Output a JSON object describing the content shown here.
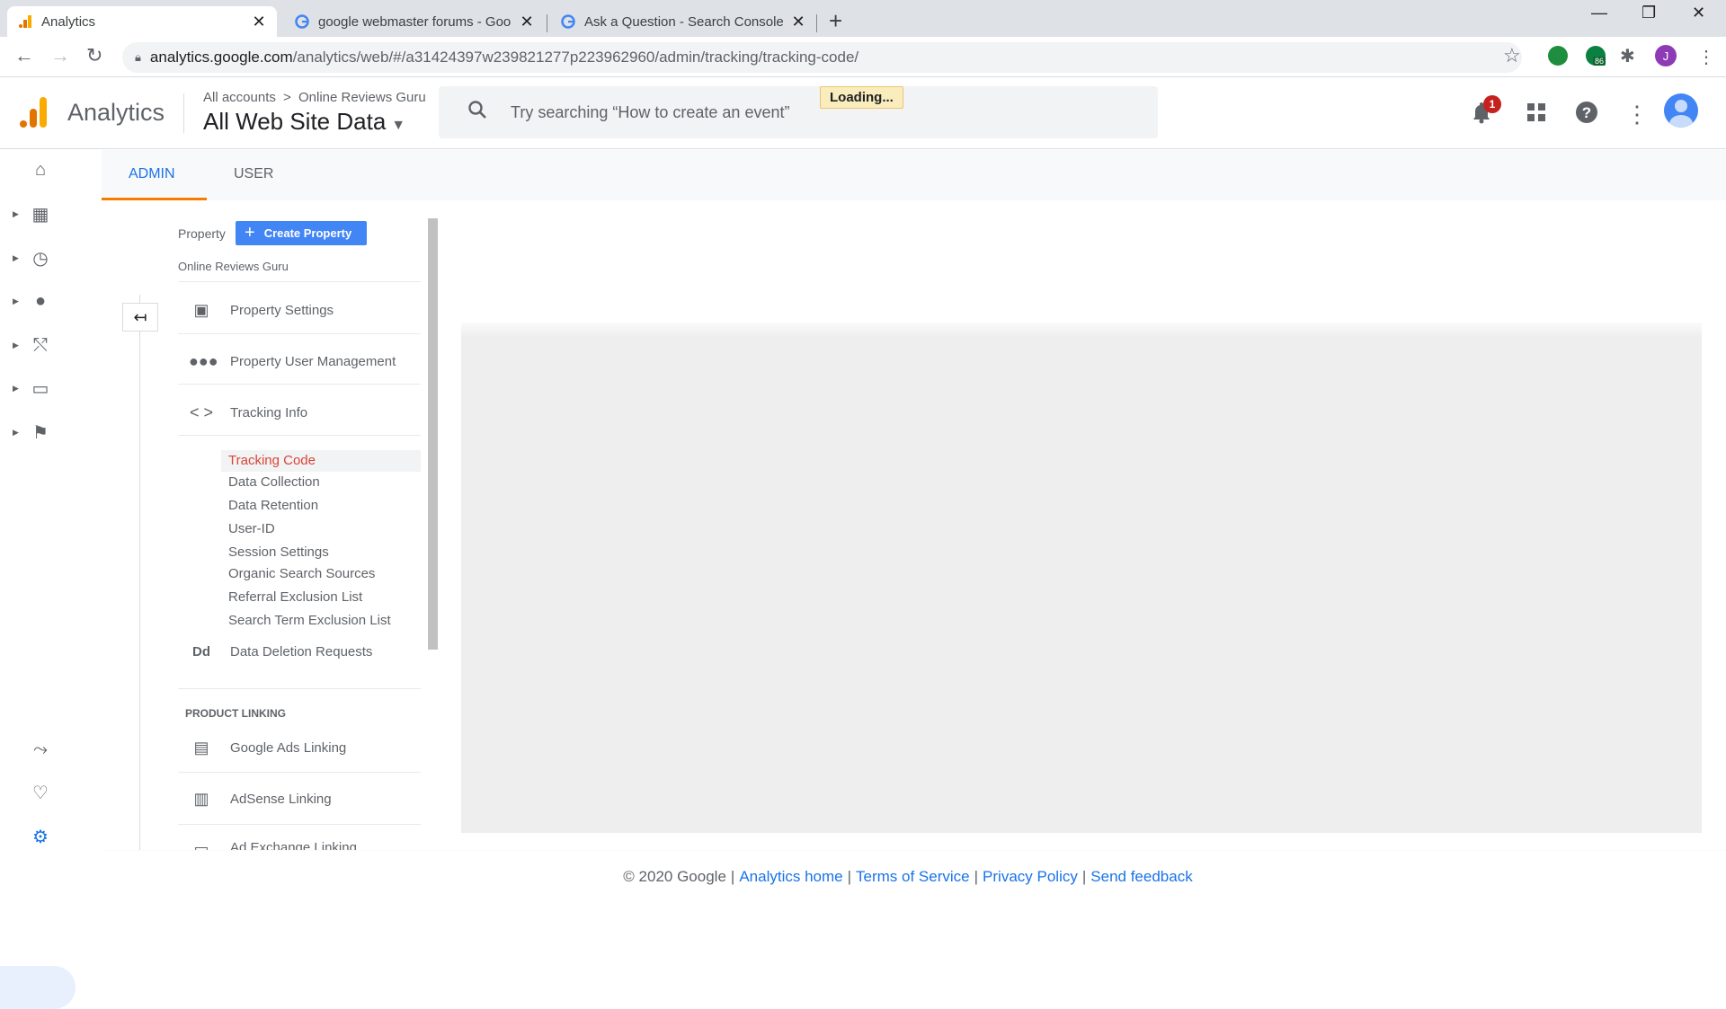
{
  "browser": {
    "tabs": [
      {
        "title": "Analytics"
      },
      {
        "title": "google webmaster forums - Goo"
      },
      {
        "title": "Ask a Question - Search Console"
      }
    ],
    "url_host": "analytics.google.com",
    "url_path": "/analytics/web/#/a31424397w239821277p223962960/admin/tracking/tracking-code/",
    "extension_badge": "86",
    "profile_initial": "J"
  },
  "header": {
    "app_name": "Analytics",
    "breadcrumb_all": "All accounts",
    "breadcrumb_sep": ">",
    "breadcrumb_account": "Online Reviews Guru",
    "view_name": "All Web Site Data",
    "search_placeholder": "Try searching “How to create an event”",
    "loading_text": "Loading...",
    "notification_count": "1"
  },
  "admin_tabs": [
    {
      "label": "ADMIN"
    },
    {
      "label": "USER"
    }
  ],
  "property_column": {
    "label": "Property",
    "create_button": "Create Property",
    "property_name": "Online Reviews Guru",
    "items": [
      {
        "label": "Property Settings"
      },
      {
        "label": "Property User Management"
      },
      {
        "label": "Tracking Info"
      }
    ],
    "tracking_sub_items": [
      {
        "label": "Tracking Code"
      },
      {
        "label": "Data Collection"
      },
      {
        "label": "Data Retention"
      },
      {
        "label": "User-ID"
      },
      {
        "label": "Session Settings"
      },
      {
        "label": "Organic Search Sources"
      },
      {
        "label": "Referral Exclusion List"
      },
      {
        "label": "Search Term Exclusion List"
      }
    ],
    "data_deletion": {
      "icon_text": "Dd",
      "label": "Data Deletion Requests"
    },
    "product_linking_heading": "PRODUCT LINKING",
    "linking_items": [
      {
        "label": "Google Ads Linking"
      },
      {
        "label": "AdSense Linking"
      },
      {
        "label": "Ad Exchange Linking"
      }
    ]
  },
  "footer": {
    "copyright": "© 2020 Google",
    "sep": "|",
    "links": [
      {
        "label": "Analytics home"
      },
      {
        "label": "Terms of Service"
      },
      {
        "label": "Privacy Policy"
      },
      {
        "label": "Send feedback"
      }
    ]
  },
  "colors": {
    "accent": "#1a73e8",
    "admin_tab_underline": "#f57c00",
    "selected_sub_item": "#db4437",
    "create_button": "#4285f4",
    "notification_badge": "#c5221f"
  }
}
